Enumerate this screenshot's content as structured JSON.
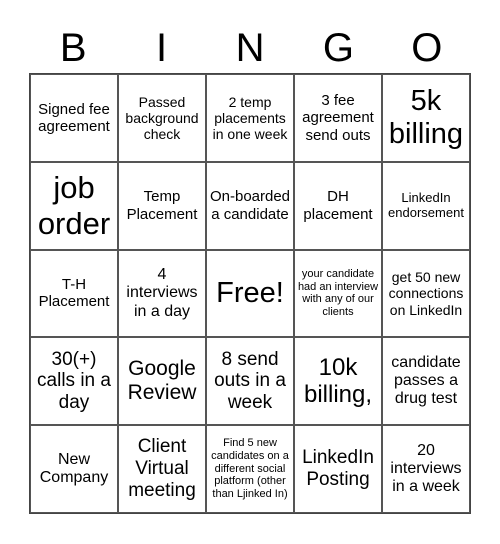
{
  "header": {
    "letters": [
      "B",
      "I",
      "N",
      "G",
      "O"
    ]
  },
  "grid": {
    "rows": [
      [
        "Signed fee agreement",
        "Passed background check",
        "2 temp placements in one week",
        "3 fee agreement send outs",
        "5k billing"
      ],
      [
        "job order",
        "Temp Placement",
        "On-boarded a candidate",
        "DH placement",
        "LinkedIn endorsement"
      ],
      [
        "T-H Placement",
        "4 interviews in a day",
        "Free!",
        "your candidate had an interview with any of our clients",
        "get 50 new connections on LinkedIn"
      ],
      [
        "30(+) calls in a day",
        "Google Review",
        "8 send outs in a week",
        "10k billing,",
        "candidate passes a drug test"
      ],
      [
        "New Company",
        "Client Virtual meeting",
        "Find 5 new candidates on a different social platform (other than Ljinked In)",
        "LinkedIn Posting",
        "20 interviews in a week"
      ]
    ]
  }
}
